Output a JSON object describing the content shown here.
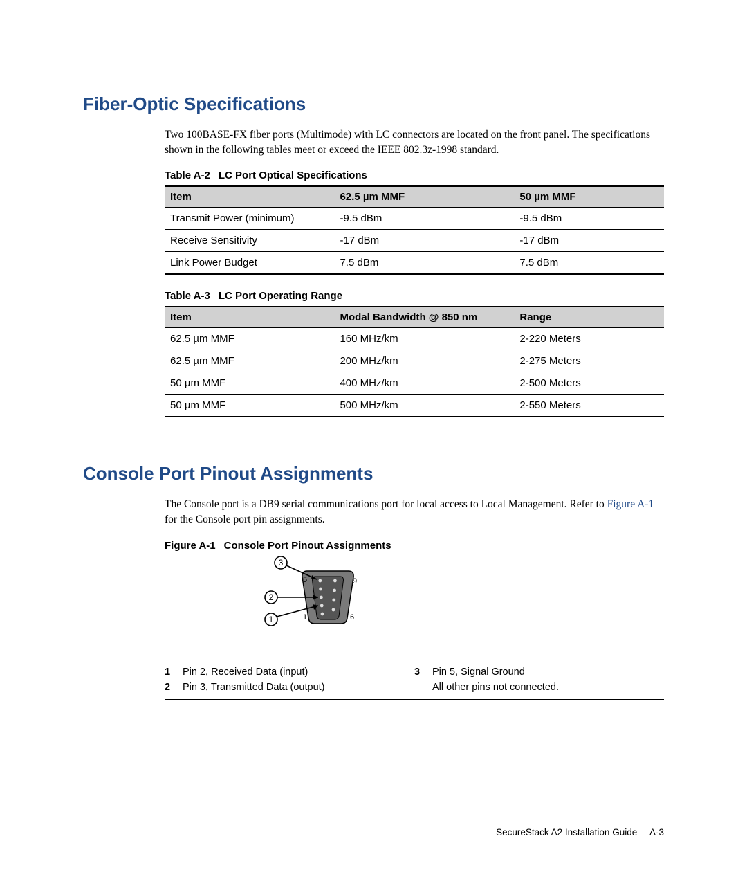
{
  "section1": {
    "heading": "Fiber-Optic Specifications",
    "para": "Two 100BASE-FX fiber ports (Multimode) with LC connectors are located on the front panel. The specifications shown in the following tables meet or exceed the IEEE 802.3z-1998 standard."
  },
  "tableA2": {
    "caption_num": "Table A-2",
    "caption_title": "LC Port Optical Specifications",
    "headers": [
      "Item",
      "62.5 µm MMF",
      "50 µm MMF"
    ],
    "rows": [
      [
        "Transmit Power (minimum)",
        "-9.5 dBm",
        "-9.5 dBm"
      ],
      [
        "Receive Sensitivity",
        "-17 dBm",
        "-17 dBm"
      ],
      [
        "Link Power Budget",
        "7.5 dBm",
        "7.5 dBm"
      ]
    ]
  },
  "tableA3": {
    "caption_num": "Table A-3",
    "caption_title": "LC Port Operating Range",
    "headers": [
      "Item",
      "Modal Bandwidth @ 850 nm",
      "Range"
    ],
    "rows": [
      [
        "62.5 µm MMF",
        "160 MHz/km",
        "2-220 Meters"
      ],
      [
        "62.5 µm MMF",
        "200 MHz/km",
        "2-275 Meters"
      ],
      [
        "50 µm MMF",
        "400 MHz/km",
        "2-500 Meters"
      ],
      [
        "50 µm MMF",
        "500 MHz/km",
        "2-550 Meters"
      ]
    ]
  },
  "section2": {
    "heading": "Console Port Pinout Assignments",
    "para_pre": "The Console port is a DB9 serial communications port for local access to Local Management. Refer to ",
    "para_link": "Figure A-1",
    "para_post": " for the Console port pin assignments."
  },
  "figure": {
    "caption_num": "Figure A-1",
    "caption_title": "Console Port Pinout Assignments",
    "labels": {
      "c3": "3",
      "c2": "2",
      "c1": "1",
      "p5": "5",
      "p1": "1",
      "p9": "9",
      "p6": "6"
    }
  },
  "legend": {
    "r1": {
      "n1": "1",
      "t1": "Pin 2, Received Data (input)",
      "n3": "3",
      "t3": "Pin 5, Signal Ground"
    },
    "r2": {
      "n2": "2",
      "t2": "Pin 3, Transmitted Data (output)",
      "t4": "All other pins not connected."
    }
  },
  "footer": {
    "book": "SecureStack A2 Installation Guide",
    "page": "A-3"
  }
}
